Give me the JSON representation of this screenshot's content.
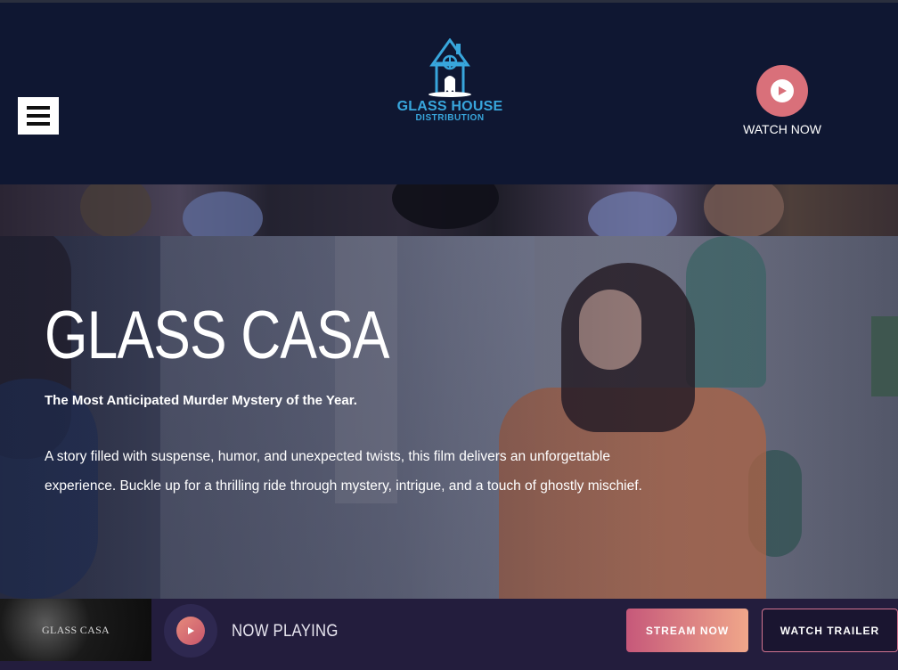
{
  "header": {
    "logo": {
      "line1": "GLASS HOUSE",
      "line2": "DISTRIBUTION",
      "icon": "glass-house-logo-icon"
    },
    "menu_icon": "hamburger-menu-icon",
    "watch_now": {
      "label": "WATCH NOW",
      "icon": "play-circle-icon"
    }
  },
  "hero": {
    "title": "GLASS CASA",
    "tagline": "The Most Anticipated Murder Mystery of the Year.",
    "description": "A story filled with suspense, humor, and unexpected twists, this film delivers an unforgettable experience. Buckle up for a thrilling ride through mystery, intrigue, and a touch of ghostly mischief."
  },
  "player_bar": {
    "thumbnail_text": "GLASS CASA",
    "play_icon": "play-icon",
    "now_playing_label": "NOW PLAYING",
    "stream_button": "STREAM NOW",
    "trailer_button": "WATCH TRAILER"
  },
  "colors": {
    "header_bg": "#0f1732",
    "accent_pink": "#d9707a",
    "logo_blue": "#38a6dc",
    "bar_bg": "#231d3d",
    "stream_gradient_start": "#c6587a",
    "stream_gradient_end": "#f0a78a"
  }
}
